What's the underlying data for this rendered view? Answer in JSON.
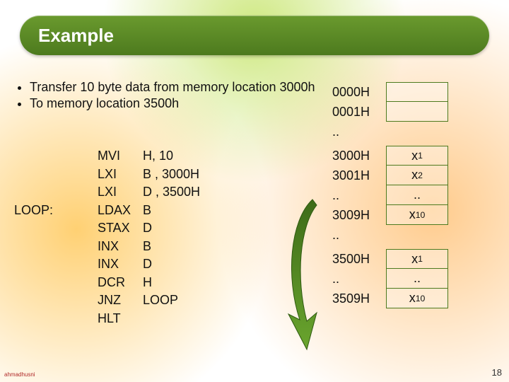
{
  "title": "Example",
  "bullets": [
    "Transfer 10 byte data from memory location 3000h",
    "To memory location 3500h"
  ],
  "code": [
    {
      "label": "",
      "mnemonic": "MVI",
      "operand": "H, 10"
    },
    {
      "label": "",
      "mnemonic": "LXI",
      "operand": "B , 3000H"
    },
    {
      "label": "",
      "mnemonic": "LXI",
      "operand": "D , 3500H"
    },
    {
      "label": "LOOP:",
      "mnemonic": "LDAX",
      "operand": "B"
    },
    {
      "label": "",
      "mnemonic": "STAX",
      "operand": "D"
    },
    {
      "label": "",
      "mnemonic": "INX",
      "operand": "B"
    },
    {
      "label": "",
      "mnemonic": "INX",
      "operand": "D"
    },
    {
      "label": "",
      "mnemonic": "DCR",
      "operand": "H"
    },
    {
      "label": "",
      "mnemonic": "JNZ",
      "operand": "LOOP"
    },
    {
      "label": "",
      "mnemonic": "HLT",
      "operand": ""
    }
  ],
  "memory": [
    {
      "addr": "0000H",
      "val": "",
      "box": true
    },
    {
      "addr": "0001H",
      "val": "",
      "box": true
    },
    {
      "addr": "..",
      "val": "",
      "box": false
    },
    {
      "addr": "3000H",
      "val": "x1",
      "box": true
    },
    {
      "addr": "3001H",
      "val": "x2",
      "box": true
    },
    {
      "addr": "..",
      "val": "..",
      "box": true
    },
    {
      "addr": "3009H",
      "val": "x10",
      "box": true
    },
    {
      "addr": "..",
      "val": "",
      "box": false
    },
    {
      "addr": "3500H",
      "val": "x1",
      "box": true
    },
    {
      "addr": "..",
      "val": "..",
      "box": true
    },
    {
      "addr": "3509H",
      "val": "x10",
      "box": true
    }
  ],
  "footer": {
    "author": "ahmadhusni",
    "page": "18"
  }
}
